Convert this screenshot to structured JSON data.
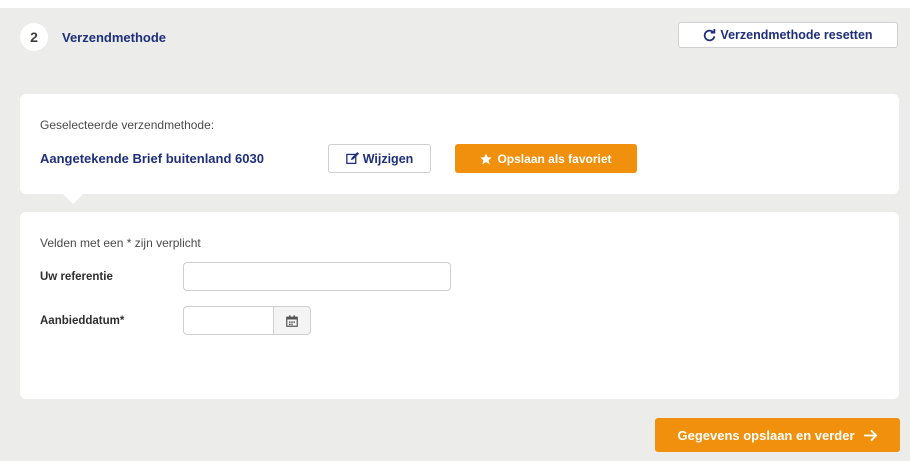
{
  "step": {
    "number": "2",
    "title": "Verzendmethode",
    "reset_label": "Verzendmethode resetten",
    "reset_icon": "refresh-icon"
  },
  "selection": {
    "label": "Geselecteerde verzendmethode:",
    "value": "Aangetekende Brief buitenland 6030",
    "edit_label": "Wijzigen",
    "edit_icon": "edit-icon",
    "favorite_label": "Opslaan als favoriet",
    "favorite_icon": "star-icon"
  },
  "form": {
    "required_note": "Velden met een * zijn verplicht",
    "reference_label": "Uw referentie",
    "reference_value": "",
    "date_label": "Aanbieddatum*",
    "date_value": "",
    "calendar_icon": "calendar-icon"
  },
  "footer": {
    "save_label": "Gegevens opslaan en verder",
    "save_icon": "arrow-right-icon"
  },
  "colors": {
    "accent": "#f0900c",
    "text_blue": "#1f2f7a",
    "background": "#ececea"
  }
}
